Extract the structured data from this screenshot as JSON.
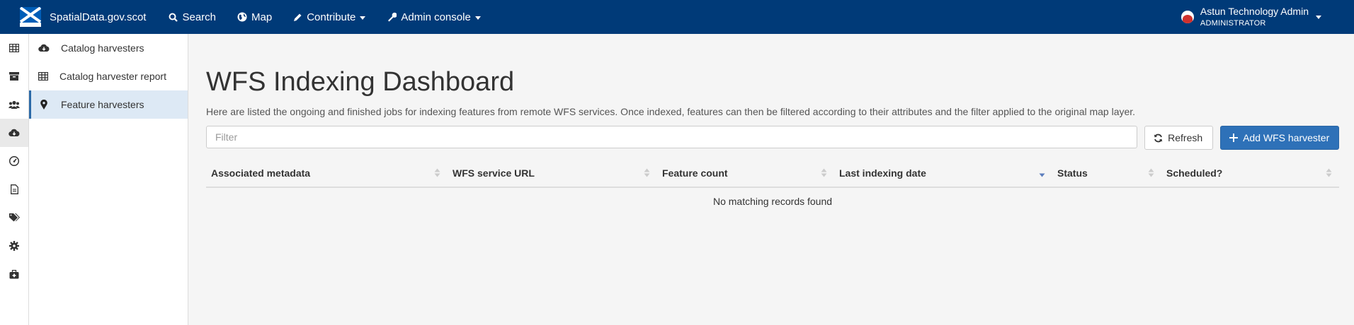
{
  "brand": {
    "name": "SpatialData.gov.scot",
    "logo_text": "GOV.SCOT"
  },
  "nav": {
    "search": "Search",
    "map": "Map",
    "contribute": "Contribute",
    "admin": "Admin console"
  },
  "user": {
    "name": "Astun Technology Admin",
    "role": "ADMINISTRATOR"
  },
  "rail_icons": [
    "table-icon",
    "archive-icon",
    "users-icon",
    "cloud-download-icon",
    "dashboard-icon",
    "file-icon",
    "tags-icon",
    "gear-icon",
    "medkit-icon"
  ],
  "rail_active_index": 3,
  "subnav": {
    "items": [
      {
        "label": "Catalog harvesters",
        "icon": "cloud-download-icon"
      },
      {
        "label": "Catalog harvester report",
        "icon": "table-icon"
      },
      {
        "label": "Feature harvesters",
        "icon": "map-marker-icon"
      }
    ],
    "active_index": 2
  },
  "page": {
    "title": "WFS Indexing Dashboard",
    "description": "Here are listed the ongoing and finished jobs for indexing features from remote WFS services. Once indexed, features can then be filtered according to their attributes and the filter applied to the original map layer.",
    "filter_placeholder": "Filter",
    "refresh_label": "Refresh",
    "add_label": "Add WFS harvester"
  },
  "table": {
    "columns": [
      "Associated metadata",
      "WFS service URL",
      "Feature count",
      "Last indexing date",
      "Status",
      "Scheduled?"
    ],
    "sorted_column_index": 3,
    "empty_message": "No matching records found"
  },
  "colors": {
    "topbar": "#003a78",
    "primary": "#2e71b8",
    "active_bg": "#dde9f5"
  }
}
